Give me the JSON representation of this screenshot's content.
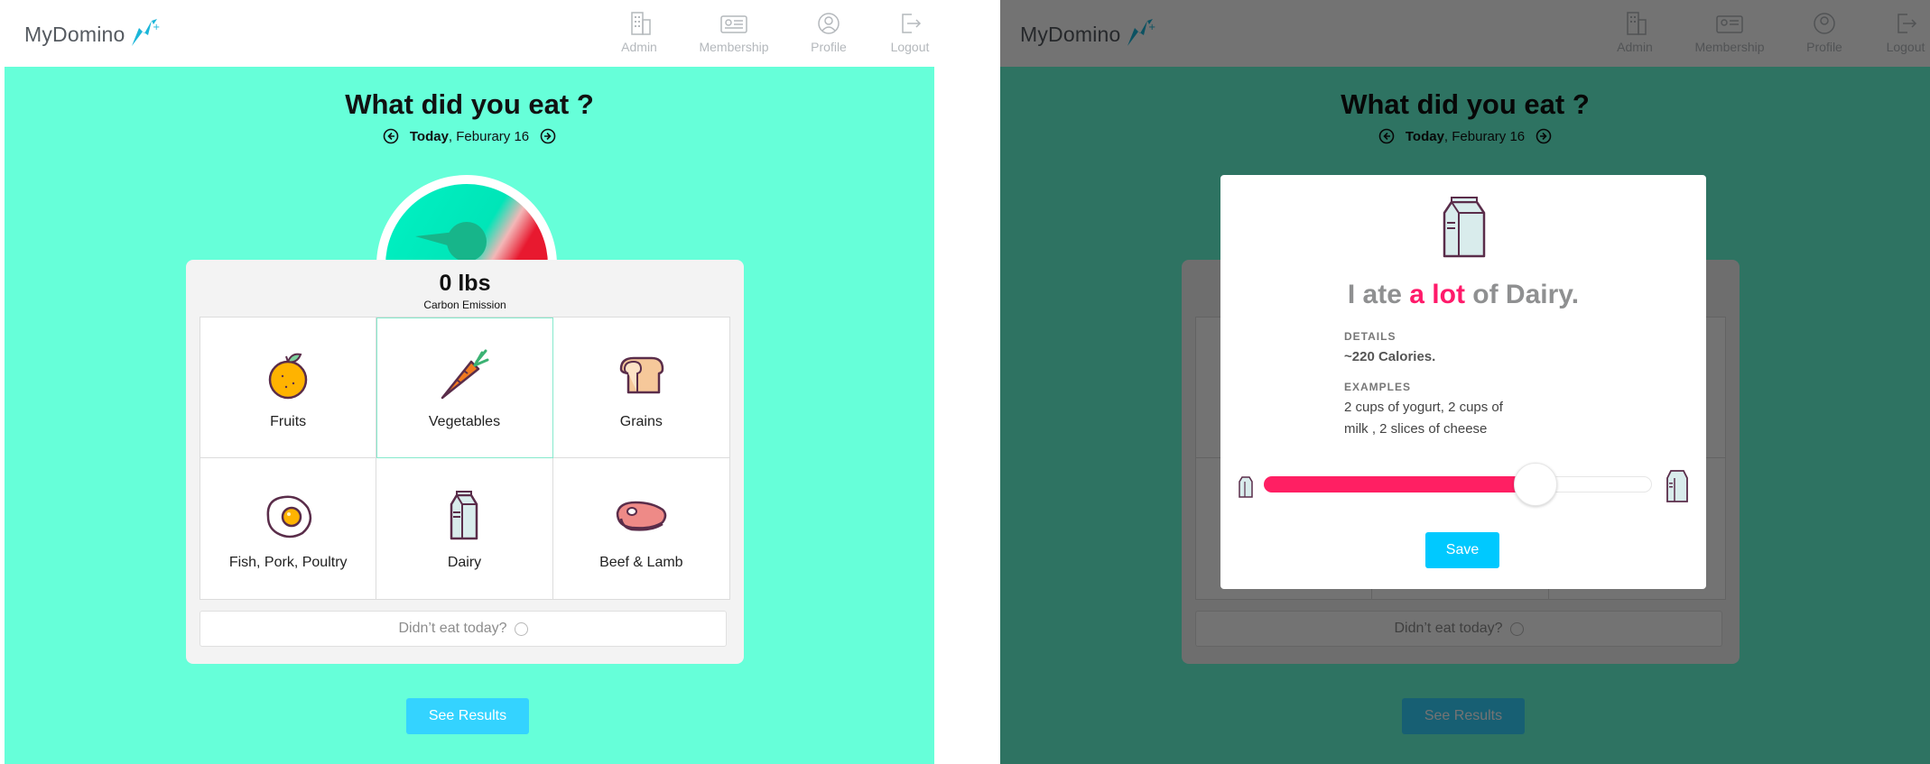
{
  "app": {
    "logo_text": "MyDomino",
    "nav": [
      {
        "label": "Admin",
        "icon": "building-icon"
      },
      {
        "label": "Membership",
        "icon": "id-card-icon"
      },
      {
        "label": "Profile",
        "icon": "user-icon"
      },
      {
        "label": "Logout",
        "icon": "logout-icon"
      }
    ],
    "heading": "What did you eat ?",
    "date_today": "Today",
    "date_rest": ", Feburary 16",
    "emission_value": "0 lbs",
    "emission_label": "Carbon Emission",
    "gauge_level": 0,
    "categories": [
      {
        "label": "Fruits",
        "icon": "orange-icon"
      },
      {
        "label": "Vegetables",
        "icon": "carrot-icon"
      },
      {
        "label": "Grains",
        "icon": "bread-icon"
      },
      {
        "label": "Fish, Pork, Poultry",
        "icon": "egg-icon"
      },
      {
        "label": "Dairy",
        "icon": "milk-carton-icon"
      },
      {
        "label": "Beef & Lamb",
        "icon": "steak-icon"
      }
    ],
    "no_eat_label": "Didn’t eat today?",
    "results_button": "See Results",
    "colors": {
      "background": "#66ffd9",
      "accent": "#34d3ff",
      "highlight": "#ff1a6a"
    }
  },
  "modal": {
    "title_prefix": "I ate",
    "title_highlight": "a lot",
    "title_suffix": "of Dairy.",
    "details_label": "DETAILS",
    "details_value": "~220 Calories.",
    "examples_label": "EXAMPLES",
    "examples_line1": "2 cups of yogurt, 2 cups of",
    "examples_line2": "milk , 2 slices of cheese",
    "slider_level_percent": 70,
    "save_button": "Save"
  }
}
